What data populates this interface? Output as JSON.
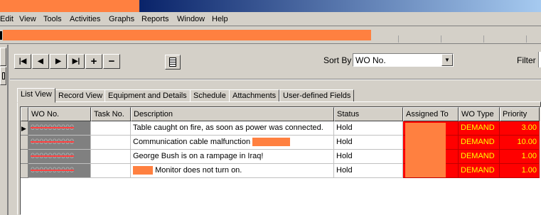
{
  "menubar": {
    "items": [
      "Edit",
      "View",
      "Tools",
      "Activities",
      "Graphs",
      "Reports",
      "Window",
      "Help"
    ]
  },
  "navigation": {
    "first_glyph": "|◀",
    "prev_glyph": "◀",
    "next_glyph": "▶",
    "last_glyph": "▶|",
    "add_glyph": "+",
    "remove_glyph": "−"
  },
  "sort": {
    "label": "Sort By",
    "selected": "WO No."
  },
  "filter": {
    "label": "Filter"
  },
  "tabs": [
    {
      "label": "List View",
      "active": true
    },
    {
      "label": "Record View"
    },
    {
      "label": "Equipment and Details"
    },
    {
      "label": "Schedule"
    },
    {
      "label": "Attachments"
    },
    {
      "label": "User-defined Fields"
    }
  ],
  "table": {
    "columns": [
      "WO No.",
      "Task No.",
      "Description",
      "Status",
      "Assigned To",
      "WO Type",
      "Priority"
    ],
    "rows": [
      {
        "wo_no": "0000000000",
        "task_no": "",
        "description": "Table caught on fire, as soon as power was connected.",
        "status": "Hold",
        "wo_type": "DEMAND",
        "priority": "3.00",
        "selected": true
      },
      {
        "wo_no": "0000000000",
        "task_no": "",
        "description": "Communication cable malfunction",
        "status": "Hold",
        "wo_type": "DEMAND",
        "priority": "10.00"
      },
      {
        "wo_no": "0000000000",
        "task_no": "",
        "description": "George Bush is on a rampage in Iraq!",
        "status": "Hold",
        "wo_type": "DEMAND",
        "priority": "1.00"
      },
      {
        "wo_no": "0000000000",
        "task_no": "",
        "description": "Monitor does not turn on.",
        "status": "Hold",
        "wo_type": "DEMAND",
        "priority": "1.00"
      }
    ]
  },
  "icons": {
    "row_pointer": "row-pointer-icon",
    "report": "report-icon"
  },
  "colors": {
    "redaction": "#ff8040",
    "demand_bg": "#ff0000",
    "demand_text": "#ffff00"
  }
}
